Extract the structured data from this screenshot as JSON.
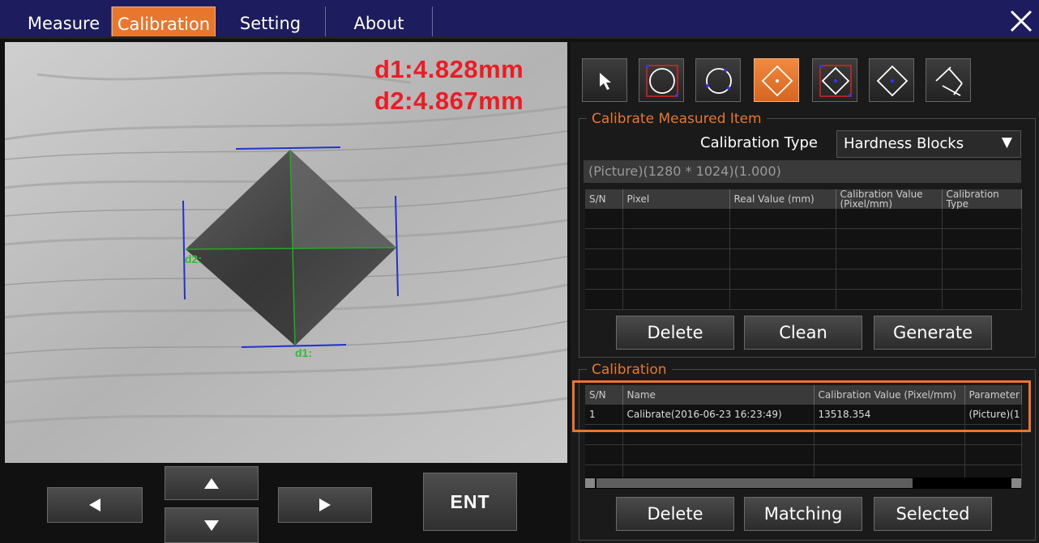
{
  "menu": {
    "tabs": [
      {
        "label": "Measure"
      },
      {
        "label": "Calibration",
        "active": true
      },
      {
        "label": "Setting"
      },
      {
        "label": "About"
      }
    ],
    "close_icon": "close-icon"
  },
  "image": {
    "measure_d1": "d1:4.828mm",
    "measure_d2": "d2:4.867mm",
    "label_d1": "d1:",
    "label_d2": "d2:"
  },
  "controls": {
    "left_icon": "arrow-left-icon",
    "right_icon": "arrow-right-icon",
    "up_icon": "arrow-up-icon",
    "down_icon": "arrow-down-icon",
    "enter_label": "ENT"
  },
  "toolbar": {
    "tools": [
      {
        "icon": "pointer-icon"
      },
      {
        "icon": "circle-box-icon"
      },
      {
        "icon": "circle-icon"
      },
      {
        "icon": "diamond-center-icon",
        "active": true
      },
      {
        "icon": "diamond-box-icon"
      },
      {
        "icon": "diamond-icon"
      },
      {
        "icon": "line-measure-icon"
      }
    ]
  },
  "calibrate_item": {
    "title": "Calibrate Measured Item",
    "type_label": "Calibration Type",
    "type_value": "Hardness Blocks",
    "param_field": "(Picture)(1280 * 1024)(1.000)",
    "columns": [
      "S/N",
      "Pixel",
      "Real Value (mm)",
      "Calibration Value (Pixel/mm)",
      "Calibration Type"
    ],
    "rows": [],
    "buttons": {
      "delete": "Delete",
      "clean": "Clean",
      "generate": "Generate"
    }
  },
  "calibration": {
    "title": "Calibration",
    "columns": [
      "S/N",
      "Name",
      "Calibration Value (Pixel/mm)",
      "Parameter"
    ],
    "rows": [
      {
        "sn": "1",
        "name": "Calibrate(2016-06-23 16:23:49)",
        "value": "13518.354",
        "parameter": "(Picture)(1"
      }
    ],
    "buttons": {
      "delete": "Delete",
      "matching": "Matching",
      "selected": "Selected"
    }
  },
  "colors": {
    "accent": "#e8772d",
    "menubar": "#1c1c5e",
    "measurement_text": "#ec1c24",
    "guide_line": "#2233cc",
    "diagonal_line": "#22aa22"
  }
}
